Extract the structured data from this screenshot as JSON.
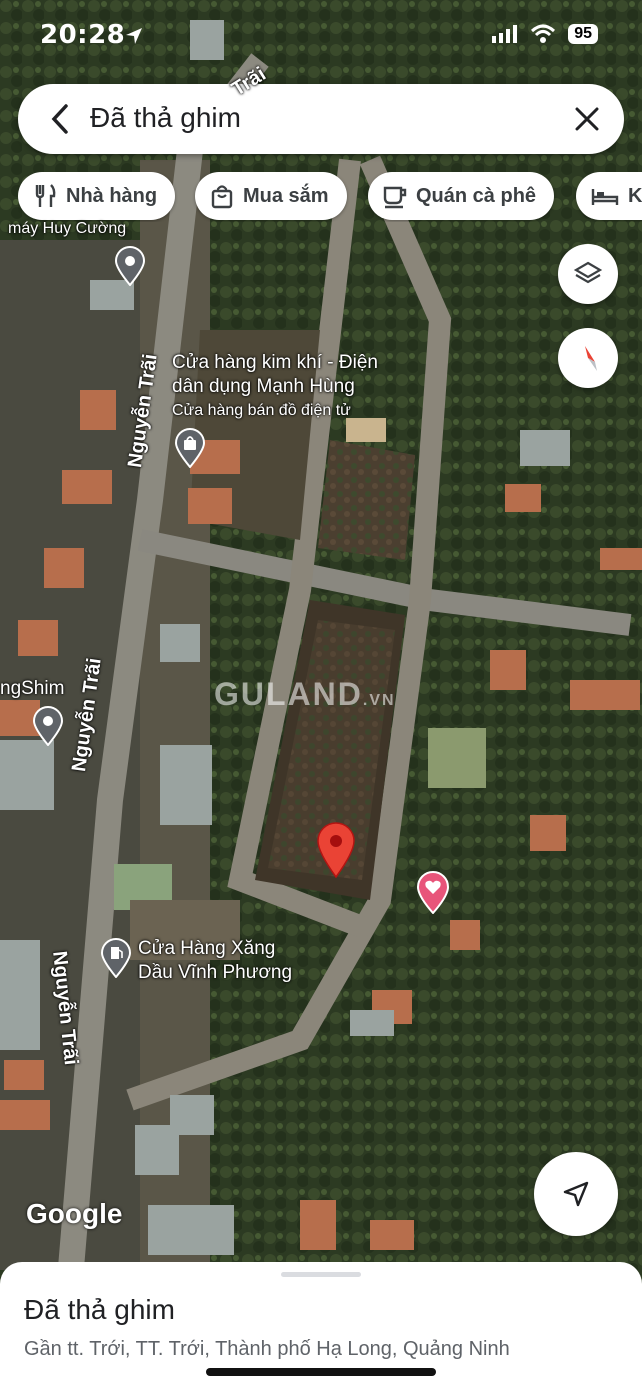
{
  "status_bar": {
    "time": "20:28",
    "battery": "95"
  },
  "search": {
    "title": "Đã thả ghim"
  },
  "chips": [
    {
      "label": "Nhà hàng",
      "icon": "fork-knife-icon"
    },
    {
      "label": "Mua sắm",
      "icon": "shopping-bag-icon"
    },
    {
      "label": "Quán cà phê",
      "icon": "coffee-cup-icon"
    },
    {
      "label": "Kh",
      "icon": "bed-icon"
    }
  ],
  "map": {
    "labels": {
      "huy_cuong": "máy Huy Cường",
      "kim_khi_line1": "Cửa hàng kim khí - Điện",
      "kim_khi_line2": "dân dụng Mạnh Hùng",
      "kim_khi_sub": "Cửa hàng bán đồ điện tử",
      "ngshim": "ngShim",
      "xang_line1": "Cửa Hàng Xăng",
      "xang_line2": "Dầu Vĩnh Phương"
    },
    "streets": {
      "trai_top": "Trãi",
      "nguyen_trai_1": "Nguyễn Trãi",
      "nguyen_trai_2": "Nguyễn Trãi",
      "nguyen_trai_3": "Nguyễn Trãi"
    },
    "watermark": {
      "main": "GULAND",
      "suffix": ".VN"
    },
    "logo": "Google",
    "colors": {
      "pin_red": "#ea4335",
      "favorite_pink": "#e8557a"
    }
  },
  "sheet": {
    "name": "Đã thả ghim",
    "address": "Gần tt. Trới, TT. Trới, Thành phố Hạ Long, Quảng Ninh"
  }
}
